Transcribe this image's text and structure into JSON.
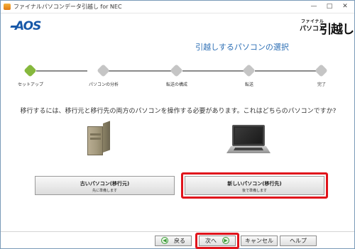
{
  "window": {
    "title": "ファイナルパソコンデータ引越し for NEC",
    "minimize_glyph": "—",
    "maximize_glyph": "□",
    "close_glyph": "✕"
  },
  "header": {
    "vendor_logo": "AOS",
    "product_logo_small": "ファイナル",
    "product_logo_mid": "パソコン",
    "product_logo_big": "引越し"
  },
  "page_title": "引越しするパソコンの選択",
  "steps": [
    {
      "label": "セットアップ",
      "active": true
    },
    {
      "label": "パソコンの分析",
      "active": false
    },
    {
      "label": "転送の構成",
      "active": false
    },
    {
      "label": "転送",
      "active": false
    },
    {
      "label": "完了",
      "active": false
    }
  ],
  "instruction": "移行するには、移行元と移行先の両方のパソコンを操作する必要があります。これはどちらのパソコンですか?",
  "choices": {
    "old": {
      "label": "古いパソコン(移行元)",
      "sub": "先に準備します"
    },
    "new": {
      "label": "新しいパソコン(移行先)",
      "sub": "後で準備します"
    }
  },
  "buttons": {
    "back": "戻る",
    "next": "次へ",
    "cancel": "キャンセル",
    "help": "ヘルプ"
  },
  "colors": {
    "accent_blue": "#2d6fb5",
    "active_step": "#86b83d",
    "highlight_red": "#e0141c"
  }
}
